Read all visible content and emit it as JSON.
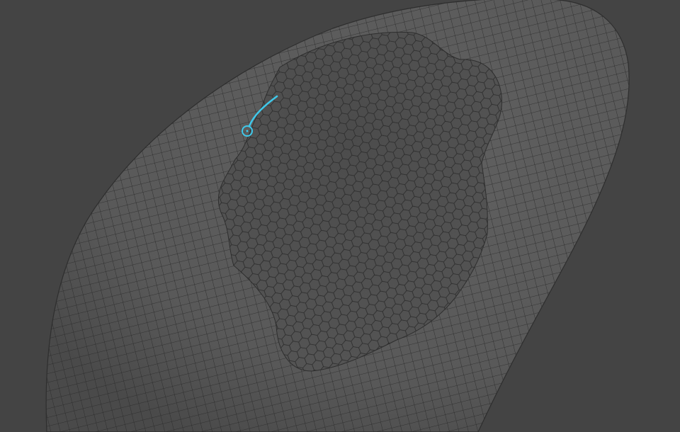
{
  "viewport": {
    "background_color": "#444444",
    "object": "sculpt-mesh",
    "mesh": {
      "outer_surface_color": "#5a5a5a",
      "recessed_patch_color": "#4f4f4f",
      "quad_wire_color": "#262626",
      "hex_wire_color": "#2a2a2a",
      "outline_color": "#2e2e2e",
      "outer_wire_pattern": "quad-grid",
      "patch_wire_pattern": "hex-grid"
    },
    "stroke": {
      "color": "#3fc8ea",
      "tool": "curve-stroke",
      "cursor": "circle-cursor"
    }
  }
}
